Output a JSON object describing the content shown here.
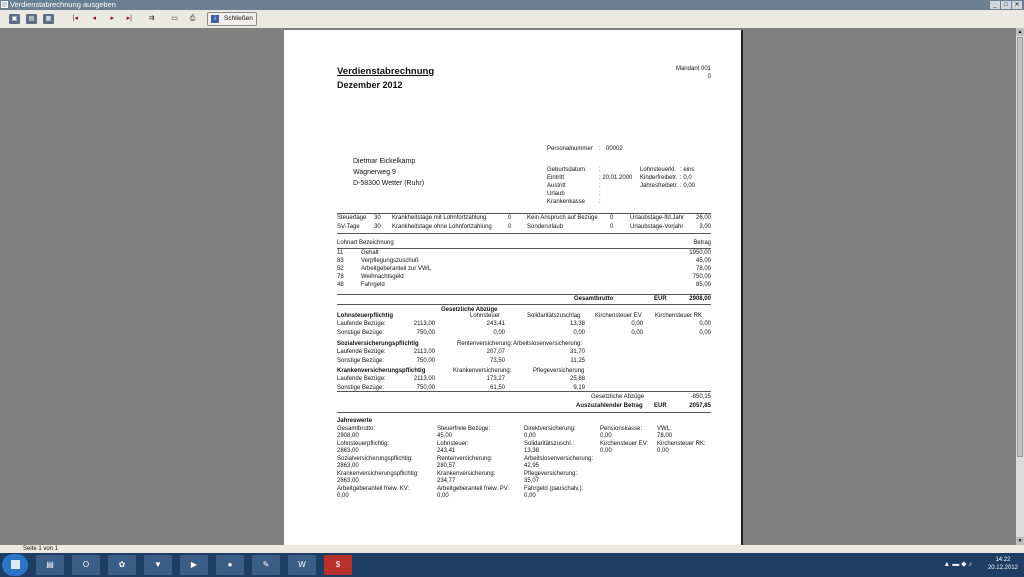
{
  "window": {
    "title": "Verdienstabrechnung ausgeben"
  },
  "toolbar": {
    "close_label": "Schließen"
  },
  "status": {
    "page": "Seite 1 von 1"
  },
  "taskbar": {
    "time": "14:22",
    "date": "20.12.2012",
    "tray": "▲ ▬ ◆ ♪"
  },
  "doc": {
    "title": "Verdienstabrechnung",
    "period": "Dezember 2012",
    "mandant": "Mandant 001",
    "mandant_sub": "0",
    "personal_label": "Personalnummer",
    "personal_sep": ":",
    "personal_value": "00002",
    "address": {
      "name": "Dietmar Eickelkamp",
      "street": "Wagnerweg 9",
      "city": "D-58300 Wetter (Ruhr)"
    },
    "info_left": [
      {
        "label": "Geburtsdatum",
        "value": ":"
      },
      {
        "label": "Eintritt",
        "value": ":  20.01.2000"
      },
      {
        "label": "Austritt",
        "value": ":"
      },
      {
        "label": "Urlaub",
        "value": ":"
      },
      {
        "label": "Krankenkasse",
        "value": ":"
      }
    ],
    "info_right": [
      {
        "label": "Lohnsteuerkl.",
        "value": ":  eins"
      },
      {
        "label": "Kinderfreibetr.",
        "value": ":  0,0"
      },
      {
        "label": "Jahresfreibetr.",
        "value": ":  0,00"
      }
    ],
    "days_row1": [
      "Steuertage",
      "30",
      "Krankheitstage mit Lohnfortzahlung",
      "0",
      "Kein Anspruch auf Bezüge",
      "0",
      "Urlaubstage-lfd.Jahr",
      "26,00"
    ],
    "days_row2": [
      "SV-Tage",
      "30",
      "Krankheitstage ohne Lohnfortzahlung",
      "0",
      "Sonderurlaub",
      "0",
      "Urlaubstage-Vorjahr",
      "3,00"
    ],
    "earn_header": {
      "col1": "Lohnart Bezeichnung",
      "col2": "Betrag"
    },
    "earnings": [
      {
        "code": "11",
        "name": "Gehalt",
        "amount": "1950,00"
      },
      {
        "code": "83",
        "name": "Verpflegungszuschuß",
        "amount": "45,00"
      },
      {
        "code": "52",
        "name": "Arbeitgeberanteil zur VWL",
        "amount": "78,00"
      },
      {
        "code": "78",
        "name": "Weihnachtsgeld",
        "amount": "750,00"
      },
      {
        "code": "48",
        "name": "Fahrgeld",
        "amount": "85,00"
      }
    ],
    "gross": {
      "label": "Gesamtbrutto",
      "cur": "EUR",
      "value": "2908,00"
    },
    "deductions_title": "Gesetzliche Abzüge",
    "lst": {
      "title": "Lohnsteuerpflichtig",
      "h_tax": "Lohnsteuer",
      "h_soli": "Solidaritätszuschlag",
      "h_kev": "Kirchensteuer EV",
      "h_krk": "Kirchensteuer RK",
      "rows": [
        {
          "label": "Laufende Bezüge:",
          "base": "2113,00",
          "tax": "243,41",
          "soli": "13,38",
          "kev": "0,00",
          "krk": "0,00"
        },
        {
          "label": "Sonstige Bezüge:",
          "base": "750,00",
          "tax": "0,00",
          "soli": "0,00",
          "kev": "0,00",
          "krk": "0,00"
        }
      ]
    },
    "sv": {
      "title": "Sozialversicherungspflichtig",
      "h_rv": "Rentenversicherung:",
      "h_av": "Arbeitslosenversicherung:",
      "rows": [
        {
          "label": "Laufende Bezüge:",
          "base": "2113,00",
          "rv": "207,07",
          "av": "31,70"
        },
        {
          "label": "Sonstige Bezüge:",
          "base": "750,00",
          "rv": "73,50",
          "av": "11,25"
        }
      ]
    },
    "kv": {
      "title": "Krankenversicherungspflichtig",
      "h_kv": "Krankenversicherung:",
      "h_pv": "Pflegeversicherung",
      "rows": [
        {
          "label": "Laufende Bezüge:",
          "base": "2113,00",
          "kv": "173,27",
          "pv": "25,88"
        },
        {
          "label": "Sonstige Bezüge:",
          "base": "750,00",
          "kv": "61,50",
          "pv": "9,19"
        }
      ]
    },
    "total_ded": {
      "label": "Gesetzliche Abzüge",
      "value": "-850,15"
    },
    "payout": {
      "label": "Auszuzahlender Betrag",
      "cur": "EUR",
      "value": "2057,85"
    },
    "annual": {
      "title": "Jahreswerte",
      "cells": [
        {
          "label": "Gesamtbrutto:",
          "value": "2908,00"
        },
        {
          "label": "Steuerfreie Bezüge:",
          "value": "45,00"
        },
        {
          "label": "Direktversicherung:",
          "value": "0,00"
        },
        {
          "label": "Pensionskasse:",
          "value": "0,00"
        },
        {
          "label": "VWL:",
          "value": "78,00"
        },
        {
          "label": "Lohnsteuerpflichtig:",
          "value": "2863,00"
        },
        {
          "label": "Lohnsteuer:",
          "value": "243,41"
        },
        {
          "label": "Solidaritätszuschl.:",
          "value": "13,38"
        },
        {
          "label": "Kirchensteuer EV:",
          "value": "0,00"
        },
        {
          "label": "Kirchensteuer RK:",
          "value": "0,00"
        },
        {
          "label": "Sozialversicherungspflichtig:",
          "value": "2863,00"
        },
        {
          "label": "Rentenversicherung:",
          "value": "280,57"
        },
        {
          "label": "Arbeitslosenversicherung:",
          "value": "42,95"
        },
        {
          "label": "Krankenversicherungspflichtig:",
          "value": "2863,00"
        },
        {
          "label": "Krankenversicherung:",
          "value": "234,77"
        },
        {
          "label": "Pflegeversicherung:",
          "value": "35,07"
        },
        {
          "label": "Arbeitgeberanteil freiw. KV:",
          "value": "0,00"
        },
        {
          "label": "Arbeitgeberanteil freiw. PV:",
          "value": "0,00"
        },
        {
          "label": "Fahrgeld (pauschalv.):",
          "value": "0,00"
        }
      ]
    }
  }
}
